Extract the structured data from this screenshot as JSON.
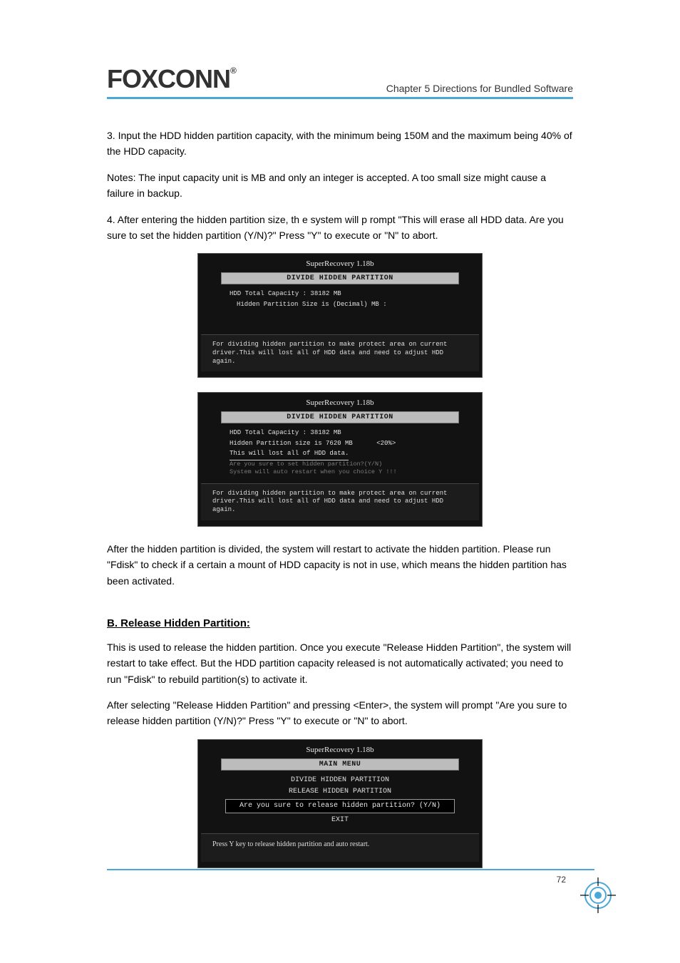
{
  "header": {
    "logo_text": "FOXCONN",
    "logo_reg": "®",
    "chapter": "Chapter 5    Directions for Bundled Software"
  },
  "page_number": "72",
  "paragraphs": {
    "p1": "3.  Input the  HDD  hidden  partition  capacity,  with  the  minimum  being 150M and the maximum being 40% of the HDD capacity.",
    "p2": "Notes: The input capacity unit is MB and only an integer is accepted. A too small size might cause a failure in backup.",
    "p3": "4.  After entering  the  hidden  partition  size, th e system  will  p rompt \"This  will  erase  all HDD  data. Are  you  sure to  set the  hidden  partition (Y/N)?\" Press \"Y\" to execute or \"N\" to abort.",
    "p4": "After the hidden partition is divided, the system will restart to activate the hidden partition. Please run \"Fdisk\" to check if a certain a mount of HDD capacity is not in use, which means the hidden partition has been activated."
  },
  "section_b": {
    "heading": "B.  Release Hidden Partition:",
    "p1": "This is used to release the hidden partition. Once you execute \"Release Hidden Partition\", the system will restart to take effect. But the HDD partition capacity released is not automatically activated; you need to run \"Fdisk\" to rebuild partition(s) to activate it.",
    "p2": "After selecting \"Release Hidden Partition\" and pressing <Enter>, the system will prompt \"Are you sure to release hidden partition (Y/N)?\" Press \"Y\" to execute or \"N\" to abort."
  },
  "screens": {
    "s1": {
      "title": "SuperRecovery 1.18b",
      "panel_header": "DIVIDE HIDDEN PARTITION",
      "line1": "HDD Total Capacity : 38182 MB",
      "line2": "Hidden Partition Size is (Decimal) MB :",
      "bottom": "For dividing hidden partition to make protect area on current driver.This will lost all of HDD data and need to adjust HDD again."
    },
    "s2": {
      "title": "SuperRecovery 1.18b",
      "panel_header": "DIVIDE HIDDEN PARTITION",
      "line1": "HDD Total Capacity : 38182 MB",
      "line2": "Hidden Partition size is 7620 MB",
      "percent": "<20%>",
      "line3": "This will lost all of HDD data.",
      "line4": "Are you sure to set hidden partition?(Y/N)",
      "line5": "System will auto restart when you choice Y !!!",
      "bottom": "For dividing hidden partition to make protect area on current driver.This will lost all of HDD data and need to adjust HDD again."
    },
    "s3": {
      "title": "SuperRecovery 1.18b",
      "panel_header": "MAIN MENU",
      "item1": "DIVIDE HIDDEN PARTITION",
      "item2": "RELEASE HIDDEN PARTITION",
      "prompt": "Are you sure to release hidden partition? (Y/N)",
      "item3": "EXIT",
      "bottom": "Press Y key to release hidden partition and auto restart."
    }
  }
}
